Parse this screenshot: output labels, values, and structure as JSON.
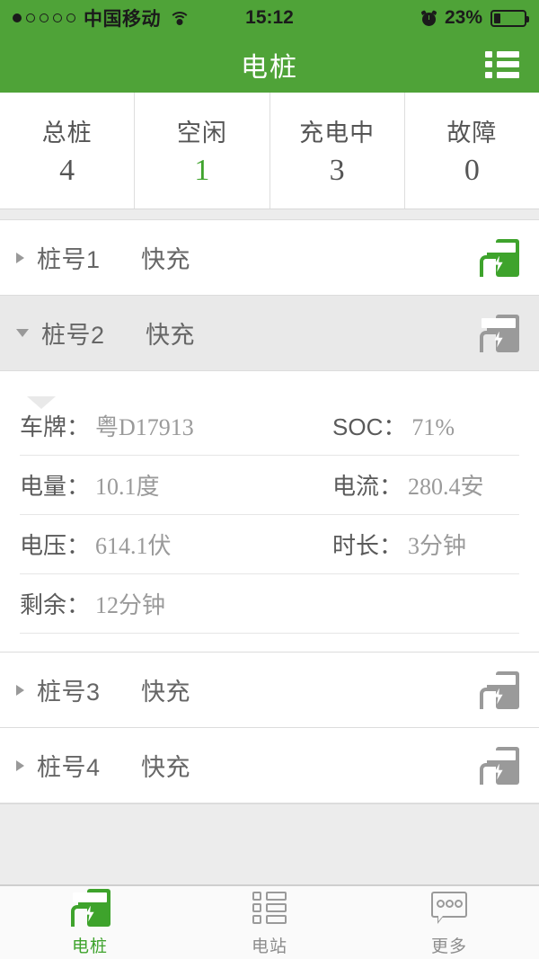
{
  "status_bar": {
    "signal_dots_total": 5,
    "signal_dots_filled": 1,
    "carrier": "中国移动",
    "wifi_icon": "wifi-icon",
    "time": "15:12",
    "alarm_icon": "alarm-icon",
    "battery_percent": "23%",
    "battery_level": 23
  },
  "header": {
    "title": "电桩",
    "menu_icon": "list-menu-icon",
    "background_color": "#4FA338"
  },
  "stats": [
    {
      "label": "总桩",
      "value": "4",
      "accent": false
    },
    {
      "label": "空闲",
      "value": "1",
      "accent": true
    },
    {
      "label": "充电中",
      "value": "3",
      "accent": false
    },
    {
      "label": "故障",
      "value": "0",
      "accent": false
    }
  ],
  "accent_color": "#3ea32c",
  "piles": [
    {
      "name": "桩号1",
      "type": "快充",
      "expanded": false,
      "icon": "charging-pile-icon",
      "icon_state": "green"
    },
    {
      "name": "桩号2",
      "type": "快充",
      "expanded": true,
      "icon": "charging-pile-icon",
      "icon_state": "gray"
    },
    {
      "name": "桩号3",
      "type": "快充",
      "expanded": false,
      "icon": "charging-pile-icon",
      "icon_state": "gray"
    },
    {
      "name": "桩号4",
      "type": "快充",
      "expanded": false,
      "icon": "charging-pile-icon",
      "icon_state": "gray"
    }
  ],
  "detail": {
    "rows": [
      {
        "left_label": "车牌：",
        "left_value": "粤D17913",
        "right_label": "SOC：",
        "right_value": "71%"
      },
      {
        "left_label": "电量：",
        "left_value": "10.1度",
        "right_label": "电流：",
        "right_value": "280.4安"
      },
      {
        "left_label": "电压：",
        "left_value": "614.1伏",
        "right_label": "时长：",
        "right_value": "3分钟"
      },
      {
        "left_label": "剩余：",
        "left_value": "12分钟",
        "right_label": "",
        "right_value": ""
      }
    ]
  },
  "tabbar": [
    {
      "label": "电桩",
      "icon": "charging-pile-icon",
      "active": true
    },
    {
      "label": "电站",
      "icon": "station-list-icon",
      "active": false
    },
    {
      "label": "更多",
      "icon": "more-chat-icon",
      "active": false
    }
  ]
}
